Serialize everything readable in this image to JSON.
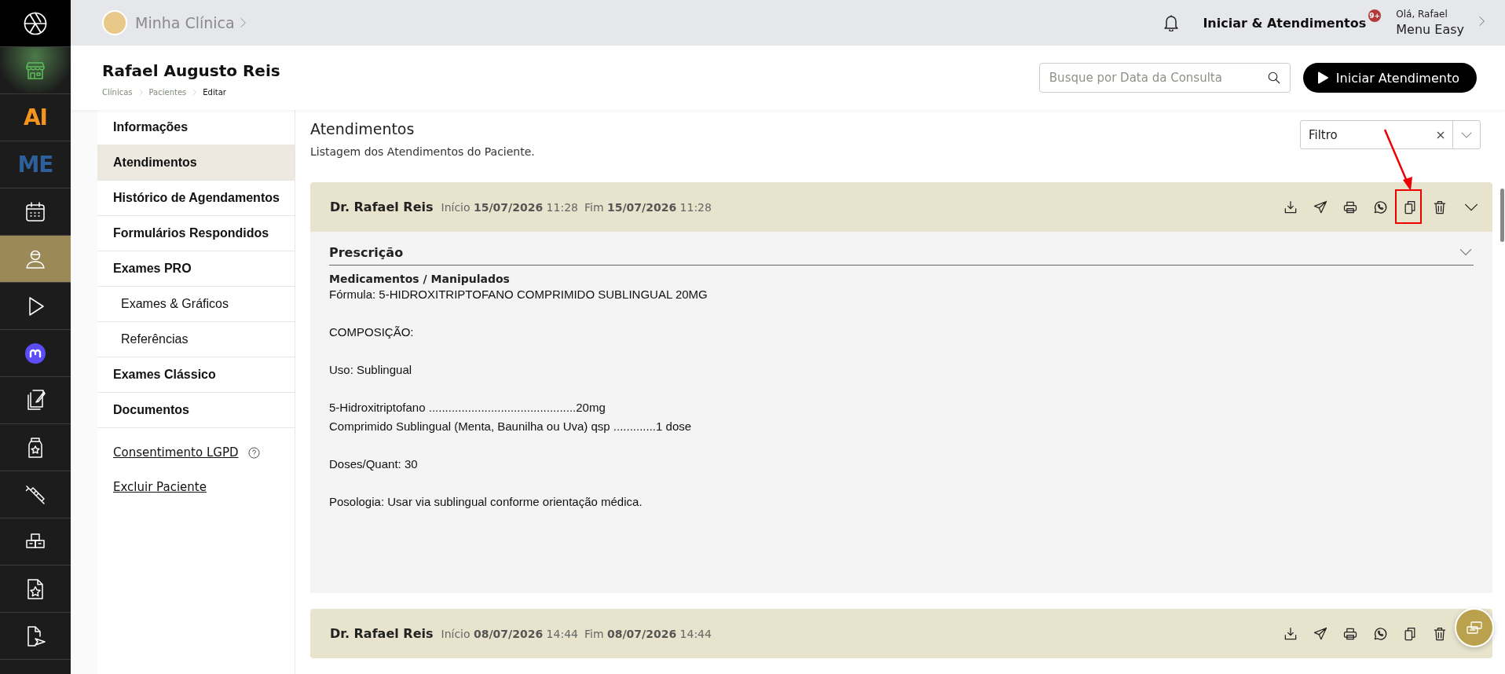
{
  "rail": {
    "items": [
      {
        "kind": "logo",
        "selected": false
      },
      {
        "kind": "store",
        "selected": false
      },
      {
        "kind": "text-logo",
        "label": "AI",
        "color": "#f7941d",
        "selected": false
      },
      {
        "kind": "text-logo",
        "label": "ME",
        "color": "#2d5f9a",
        "selected": false
      },
      {
        "kind": "calendar",
        "selected": false
      },
      {
        "kind": "user",
        "selected": true
      },
      {
        "kind": "play",
        "selected": false
      },
      {
        "kind": "m-badge",
        "selected": false
      },
      {
        "kind": "notes",
        "selected": false
      },
      {
        "kind": "bottle",
        "selected": false
      },
      {
        "kind": "syringe",
        "selected": false
      },
      {
        "kind": "boxes",
        "selected": false
      },
      {
        "kind": "star-doc",
        "selected": false
      },
      {
        "kind": "send-doc",
        "selected": false
      }
    ]
  },
  "topbar": {
    "clinic": "Minha Clínica",
    "attendances": "Iniciar & Atendimentos",
    "badge": "9+",
    "greeting": "Olá, Rafael",
    "menu": "Menu Easy"
  },
  "header": {
    "patient": "Rafael Augusto Reis",
    "breadcrumb": [
      "Clínicas",
      "Pacientes",
      "Editar"
    ],
    "search": {
      "placeholder": "Busque por Data da Consulta"
    },
    "start_button": "Iniciar Atendimento"
  },
  "submenu": {
    "items": [
      {
        "label": "Informações",
        "selected": false
      },
      {
        "label": "Atendimentos",
        "selected": true
      },
      {
        "label": "Histórico de Agendamentos",
        "selected": false
      },
      {
        "label": "Formulários Respondidos",
        "selected": false
      },
      {
        "label": "Exames PRO",
        "selected": false,
        "children": [
          {
            "label": "Exames & Gráficos",
            "selected": false
          },
          {
            "label": "Referências",
            "selected": false
          }
        ]
      },
      {
        "label": "Exames Clássico",
        "selected": false
      },
      {
        "label": "Documentos",
        "selected": false
      }
    ],
    "links": [
      {
        "label": "Consentimento LGPD",
        "help": true
      },
      {
        "label": "Excluir Paciente",
        "help": false
      }
    ]
  },
  "content": {
    "title": "Atendimentos",
    "subtitle": "Listagem dos Atendimentos do Paciente.",
    "filter": {
      "value": "Filtro"
    },
    "cards": [
      {
        "doctor": "Dr. Rafael Reis",
        "start_label": "Início",
        "start_date": "15/07/2026",
        "start_time": "11:28",
        "end_label": "Fim",
        "end_date": "15/07/2026",
        "end_time": "11:28",
        "expanded": true,
        "actions": [
          {
            "kind": "download",
            "highlighted": false
          },
          {
            "kind": "send",
            "highlighted": false
          },
          {
            "kind": "print",
            "highlighted": false
          },
          {
            "kind": "whatsapp",
            "highlighted": false
          },
          {
            "kind": "copy",
            "highlighted": true
          },
          {
            "kind": "delete",
            "highlighted": false
          }
        ],
        "section": {
          "title": "Prescrição",
          "expanded": true,
          "heading": "Medicamentos / Manipulados",
          "paragraphs": [
            [
              "Fórmula: 5-HIDROXITRIPTOFANO COMPRIMIDO SUBLINGUAL 20MG"
            ],
            [
              "COMPOSIÇÃO:"
            ],
            [
              "Uso: Sublingual"
            ],
            [
              "5-Hidroxitriptofano .............................................20mg",
              "Comprimido Sublingual (Menta, Baunilha ou Uva) qsp .............1 dose"
            ],
            [
              "Doses/Quant: 30"
            ],
            [
              "Posologia: Usar via sublingual conforme orientação médica."
            ]
          ]
        }
      },
      {
        "doctor": "Dr. Rafael Reis",
        "start_label": "Início",
        "start_date": "08/07/2026",
        "start_time": "14:44",
        "end_label": "Fim",
        "end_date": "08/07/2026",
        "end_time": "14:44",
        "expanded": false,
        "actions": [
          {
            "kind": "download",
            "highlighted": false
          },
          {
            "kind": "send",
            "highlighted": false
          },
          {
            "kind": "print",
            "highlighted": false
          },
          {
            "kind": "whatsapp",
            "highlighted": false
          },
          {
            "kind": "copy",
            "highlighted": false
          },
          {
            "kind": "delete",
            "highlighted": false
          }
        ]
      }
    ]
  }
}
